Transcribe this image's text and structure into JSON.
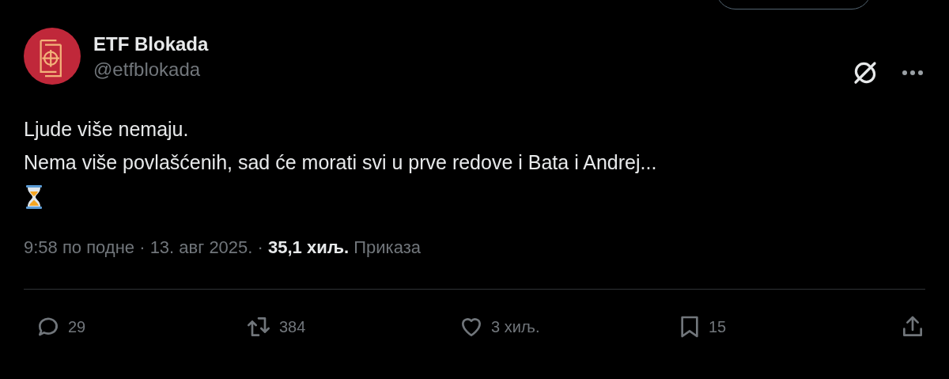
{
  "author": {
    "name": "ETF Blokada",
    "handle": "@etfblokada"
  },
  "text_lines": [
    "Ljude više nemaju.",
    "Nema više povlašćenih, sad će morati svi u prve redove i Bata i Andrej..."
  ],
  "meta": "9:58 по подне · 13. авг 2025. · **35,1 хиљ.** Приказа",
  "actions": [
    {
      "kind": "reply",
      "count": "29"
    },
    {
      "kind": "repost",
      "count": "384"
    },
    {
      "kind": "like",
      "count": "3 хиљ."
    },
    {
      "kind": "bookmark",
      "count": "15"
    },
    {
      "kind": "share"
    }
  ]
}
